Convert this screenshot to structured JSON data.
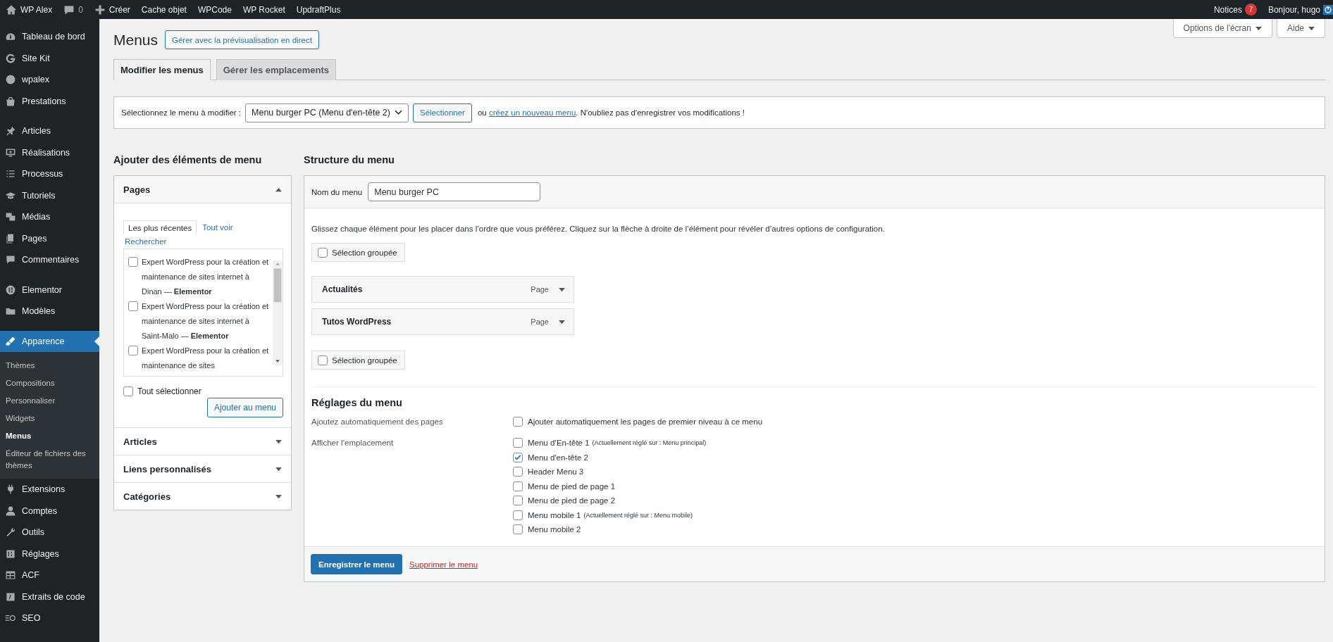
{
  "admin_bar": {
    "items": [
      {
        "label": "WP Alex"
      },
      {
        "label": "0"
      },
      {
        "label": "Créer"
      },
      {
        "label": "Cache objet"
      },
      {
        "label": "WPCode"
      },
      {
        "label": "WP Rocket"
      },
      {
        "label": "UpdraftPlus"
      }
    ],
    "notices": {
      "label": "Notices",
      "count": "7"
    },
    "greeting": "Bonjour, hugo"
  },
  "sidebar": {
    "sections": [
      {
        "items": [
          {
            "label": "Tableau de bord",
            "selected": false
          },
          {
            "label": "Site Kit",
            "selected": false
          },
          {
            "label": "wpalex",
            "selected": false
          },
          {
            "label": "Prestations",
            "selected": false
          }
        ]
      },
      {
        "items": [
          {
            "label": "Articles",
            "selected": false
          },
          {
            "label": "Réalisations",
            "selected": false
          },
          {
            "label": "Processus",
            "selected": false
          },
          {
            "label": "Tutoriels",
            "selected": false
          },
          {
            "label": "Médias",
            "selected": false
          },
          {
            "label": "Pages",
            "selected": false
          },
          {
            "label": "Commentaires",
            "selected": false
          }
        ]
      },
      {
        "items": [
          {
            "label": "Elementor",
            "selected": false
          },
          {
            "label": "Modèles",
            "selected": false
          }
        ]
      },
      {
        "items": [
          {
            "label": "Apparence",
            "selected": true,
            "children": [
              {
                "label": "Thèmes",
                "selected": false
              },
              {
                "label": "Compositions",
                "selected": false
              },
              {
                "label": "Personnaliser",
                "selected": false
              },
              {
                "label": "Widgets",
                "selected": false
              },
              {
                "label": "Menus",
                "selected": true
              },
              {
                "label": "Éditeur de fichiers des thèmes",
                "selected": false
              }
            ]
          },
          {
            "label": "Extensions",
            "selected": false
          },
          {
            "label": "Comptes",
            "selected": false
          },
          {
            "label": "Outils",
            "selected": false
          },
          {
            "label": "Réglages",
            "selected": false
          },
          {
            "label": "ACF",
            "selected": false
          },
          {
            "label": "Extraits de code",
            "selected": false
          },
          {
            "label": "SEO",
            "selected": false
          }
        ]
      }
    ]
  },
  "page": {
    "title": "Menus",
    "live_preview_button": "Gérer avec la prévisualisation en direct"
  },
  "screen_meta": [
    {
      "label": "Options de l'écran"
    },
    {
      "label": "Aide"
    }
  ],
  "tabs": [
    {
      "label": "Modifier les menus",
      "selected": true
    },
    {
      "label": "Gérer les emplacements",
      "selected": false
    }
  ],
  "menu_select": {
    "label": "Sélectionnez le menu à modifier :",
    "value": "Menu burger PC (Menu d'en-tête 2)",
    "button": "Sélectionner",
    "note_before": "ou ",
    "link": "créez un nouveau menu",
    "note_after": ". N'oubliez pas d'enregistrer vos modifications !"
  },
  "add_items": {
    "heading": "Ajouter des éléments de menu",
    "sections": [
      {
        "title": "Pages",
        "expanded": true,
        "tabs": [
          {
            "label": "Les plus récentes",
            "selected": true
          },
          {
            "label": "Tout voir",
            "selected": false
          },
          {
            "label": "Rechercher",
            "selected": false
          }
        ],
        "pages": [
          {
            "label": "Expert WordPress pour la création et maintenance de sites internet à Dinan — **Elementor**",
            "checked": false
          },
          {
            "label": "Expert WordPress pour la création et maintenance de sites internet à Saint-Malo — **Elementor**",
            "checked": false
          },
          {
            "label": "Expert WordPress pour la création et maintenance de sites",
            "checked": false
          }
        ],
        "select_all": {
          "label": "Tout sélectionner",
          "checked": false
        },
        "button": "Ajouter au menu"
      },
      {
        "title": "Articles",
        "expanded": false
      },
      {
        "title": "Liens personnalisés",
        "expanded": false
      },
      {
        "title": "Catégories",
        "expanded": false
      }
    ]
  },
  "structure": {
    "heading": "Structure du menu",
    "name_label": "Nom du menu",
    "name_value": "Menu burger PC",
    "instructions": "Glissez chaque élément pour les placer dans l’ordre que vous préférez. Cliquez sur la flèche à droite de l’élément pour révéler d’autres options de configuration.",
    "bulk_top": {
      "label": "Sélection groupée",
      "checked": false
    },
    "items": [
      {
        "title": "Actualités",
        "type": "Page"
      },
      {
        "title": "Tutos WordPress",
        "type": "Page"
      }
    ],
    "bulk_bottom": {
      "label": "Sélection groupée",
      "checked": false
    },
    "settings": {
      "heading": "Réglages du menu",
      "auto_add": {
        "label": "Ajoutez automatiquement des pages",
        "option": {
          "label": "Ajouter automatiquement les pages de premier niveau à ce menu",
          "checked": false
        }
      },
      "locations": {
        "label": "Afficher l’emplacement",
        "options": [
          {
            "label": "Menu d’En-tête 1",
            "note": "(Actuellement réglé sur : Menu principal)",
            "checked": false
          },
          {
            "label": "Menu d'en-tête 2",
            "checked": true
          },
          {
            "label": "Header Menu 3",
            "checked": false
          },
          {
            "label": "Menu de pied de page 1",
            "checked": false
          },
          {
            "label": "Menu de pied de page 2",
            "checked": false
          },
          {
            "label": "Menu mobile 1",
            "note": "(Actuellement réglé sur : Menu mobile)",
            "checked": false
          },
          {
            "label": "Menu mobile 2",
            "checked": false
          }
        ]
      }
    },
    "save_button": "Enregistrer le menu",
    "delete_link": "Supprimer le menu"
  }
}
